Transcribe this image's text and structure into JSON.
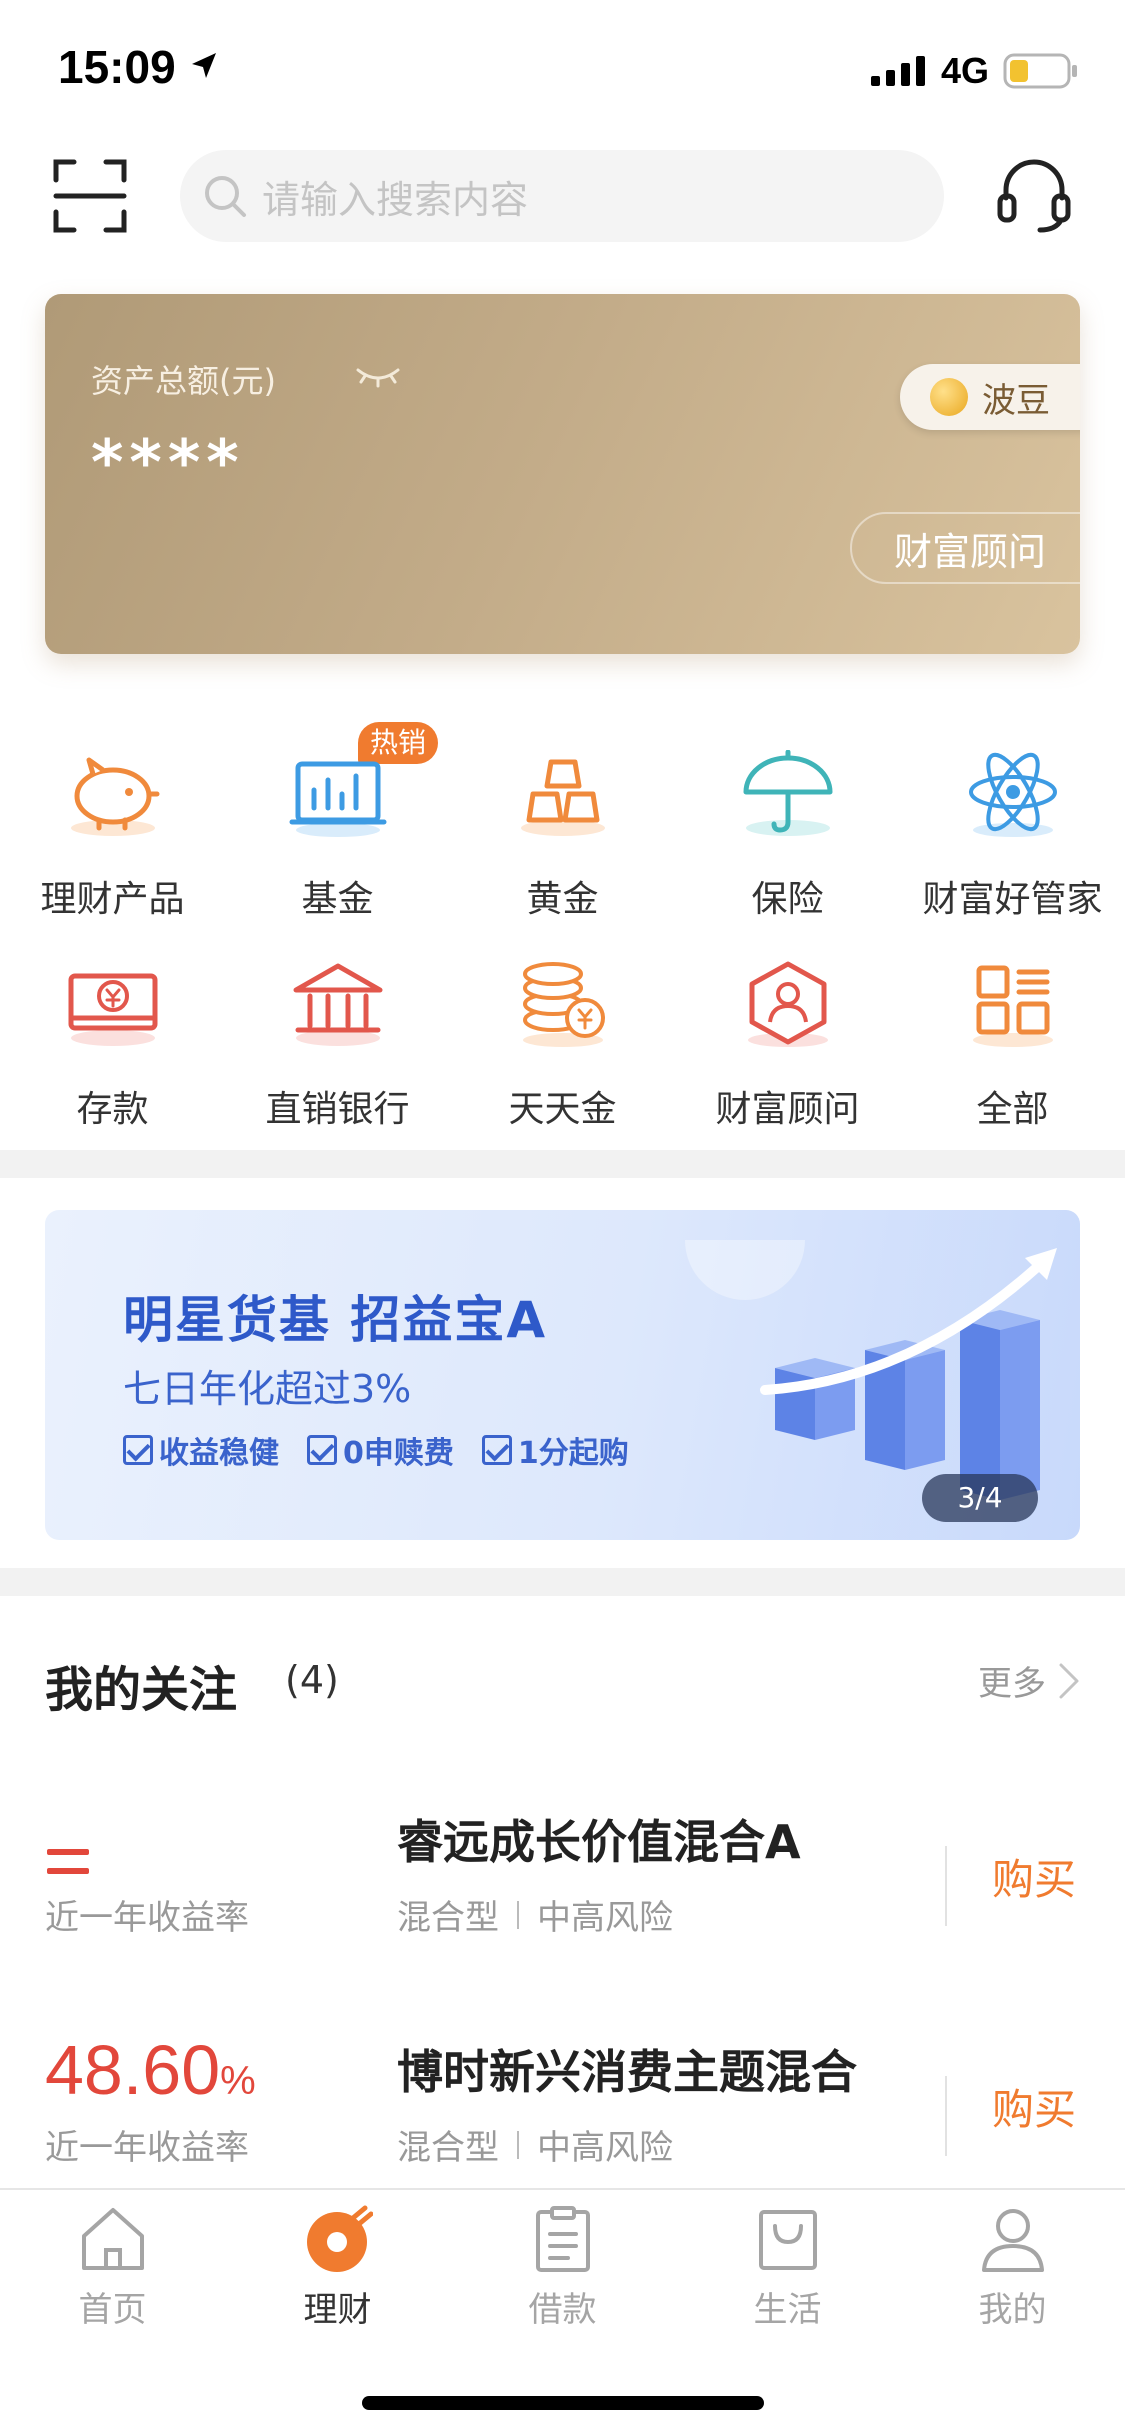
{
  "status": {
    "time": "15:09",
    "network": "4G"
  },
  "search": {
    "placeholder": "请输入搜索内容"
  },
  "asset": {
    "label": "资产总额(元)",
    "amount": "****",
    "bean_label": "波豆",
    "advisor_label": "财富顾问"
  },
  "grid": {
    "hot_badge": "热销",
    "items": [
      {
        "label": "理财产品",
        "icon": "piggy-bank-icon"
      },
      {
        "label": "基金",
        "icon": "fund-chart-icon"
      },
      {
        "label": "黄金",
        "icon": "gold-bars-icon"
      },
      {
        "label": "保险",
        "icon": "umbrella-icon"
      },
      {
        "label": "财富好管家",
        "icon": "atom-icon"
      },
      {
        "label": "存款",
        "icon": "deposit-icon"
      },
      {
        "label": "直销银行",
        "icon": "bank-icon"
      },
      {
        "label": "天天金",
        "icon": "coins-icon"
      },
      {
        "label": "财富顾问",
        "icon": "advisor-icon"
      },
      {
        "label": "全部",
        "icon": "grid-all-icon"
      }
    ]
  },
  "banner": {
    "title": "明星货基 招益宝A",
    "subtitle": "七日年化超过3%",
    "tags": [
      "收益稳健",
      "0申赎费",
      "1分起购"
    ],
    "page": "3/4"
  },
  "watchlist": {
    "title": "我的关注",
    "count": "(4)",
    "more": "更多",
    "funds": [
      {
        "rate": "",
        "rate_label": "近一年收益率",
        "name": "睿远成长价值混合A",
        "type": "混合型",
        "risk": "中高风险",
        "action": "购买"
      },
      {
        "rate": "48.60",
        "rate_unit": "%",
        "rate_label": "近一年收益率",
        "name": "博时新兴消费主题混合",
        "type": "混合型",
        "risk": "中高风险",
        "action": "购买"
      }
    ]
  },
  "tabs": [
    {
      "label": "首页",
      "icon": "home-icon"
    },
    {
      "label": "理财",
      "icon": "wealth-icon"
    },
    {
      "label": "借款",
      "icon": "loan-icon"
    },
    {
      "label": "生活",
      "icon": "shopping-bag-icon"
    },
    {
      "label": "我的",
      "icon": "person-icon"
    }
  ],
  "colors": {
    "accent": "#f07b2f",
    "rate_red": "#e2473b",
    "banner_blue": "#2e59c9",
    "card_gold": "#c2ab88"
  }
}
